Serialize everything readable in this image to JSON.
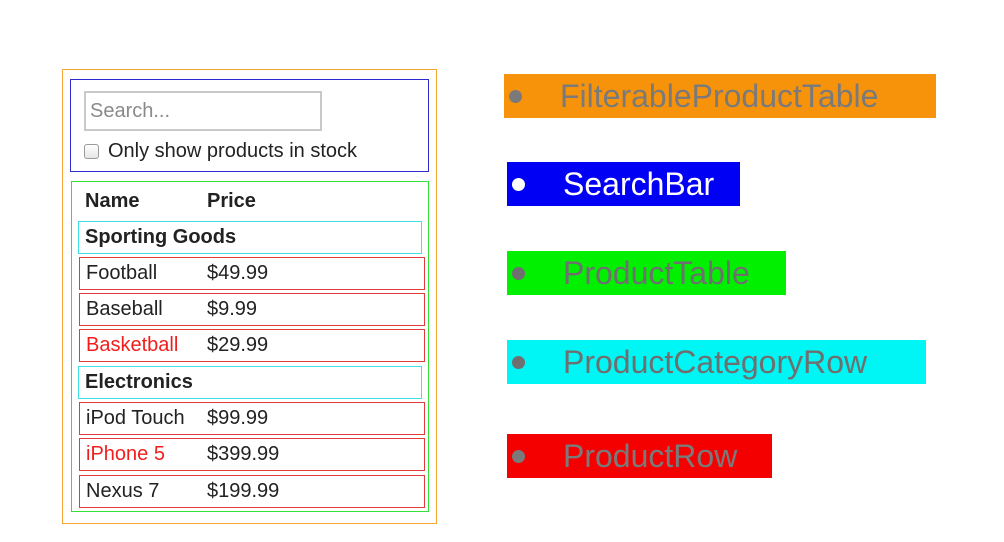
{
  "search": {
    "placeholder": "Search..."
  },
  "stock_filter": {
    "label": "Only show products in stock"
  },
  "table": {
    "headers": {
      "name": "Name",
      "price": "Price"
    },
    "categories": [
      {
        "name": "Sporting Goods",
        "products": [
          {
            "name": "Football",
            "price": "$49.99",
            "stocked": true
          },
          {
            "name": "Baseball",
            "price": "$9.99",
            "stocked": true
          },
          {
            "name": "Basketball",
            "price": "$29.99",
            "stocked": false
          }
        ]
      },
      {
        "name": "Electronics",
        "products": [
          {
            "name": "iPod Touch",
            "price": "$99.99",
            "stocked": true
          },
          {
            "name": "iPhone 5",
            "price": "$399.99",
            "stocked": false
          },
          {
            "name": "Nexus 7",
            "price": "$199.99",
            "stocked": true
          }
        ]
      }
    ]
  },
  "legend": [
    {
      "label": "FilterableProductTable",
      "color": "#f7930a",
      "text_color": "#7a7a7a"
    },
    {
      "label": "SearchBar",
      "color": "#0000f5",
      "text_color": "#ffffff"
    },
    {
      "label": "ProductTable",
      "color": "#00f000",
      "text_color": "#6f6f6f"
    },
    {
      "label": "ProductCategoryRow",
      "color": "#00f5f5",
      "text_color": "#6f6f6f"
    },
    {
      "label": "ProductRow",
      "color": "#f50000",
      "text_color": "#7a7a7a"
    }
  ]
}
